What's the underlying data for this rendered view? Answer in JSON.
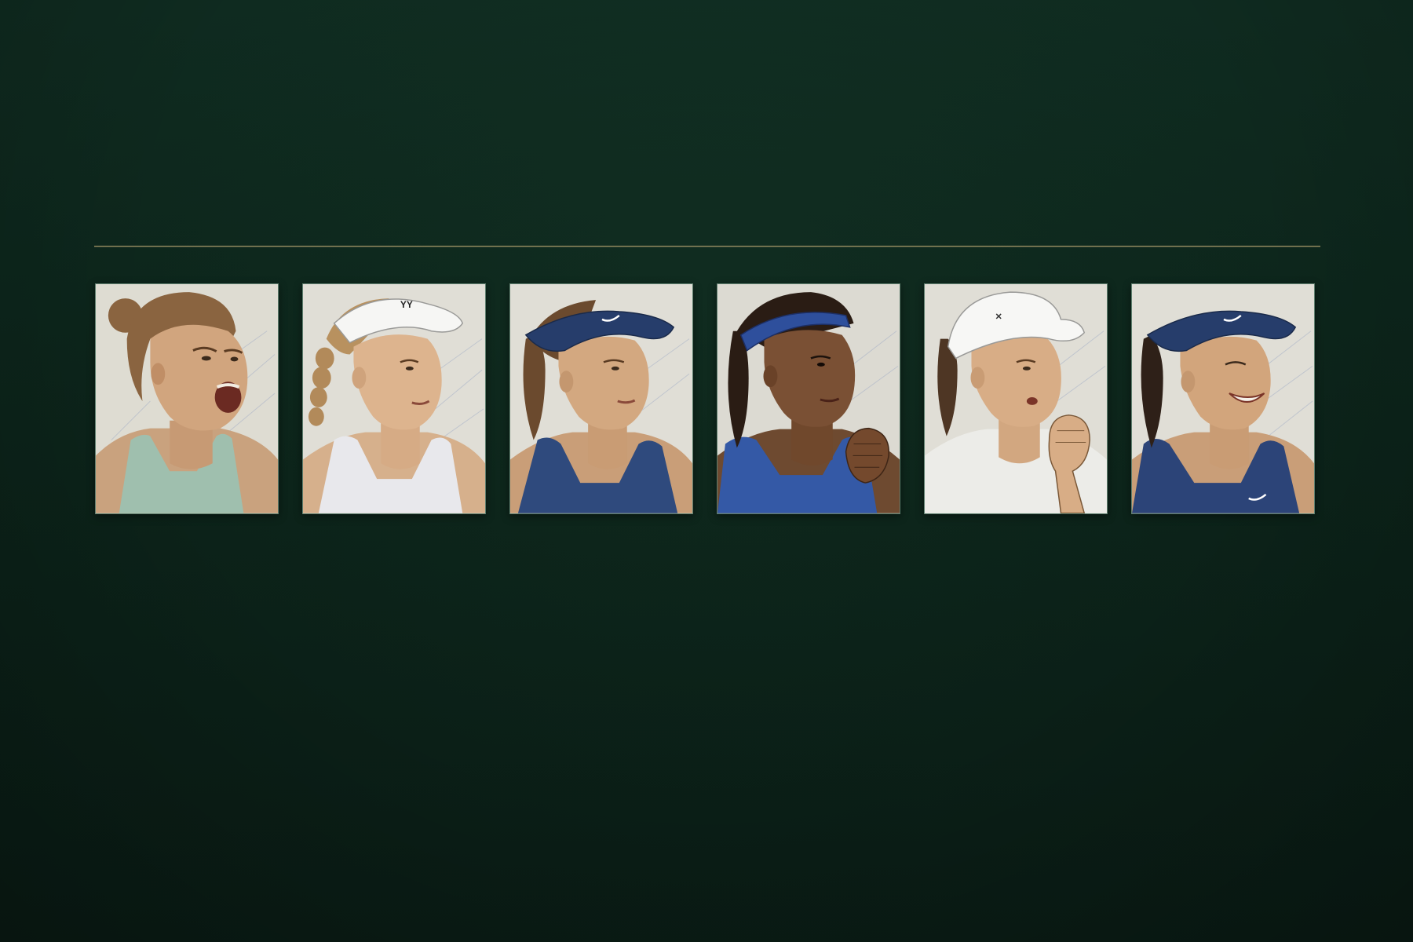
{
  "colors": {
    "background_top": "#0f2b20",
    "background_bottom": "#0a1c15",
    "divider": "#a89a6a",
    "card_border": "#5f7f6f",
    "paper": "#dcdcd4"
  },
  "portraits": [
    {
      "icon": "player-portrait-1",
      "expression": "shouting",
      "headwear": "none",
      "top": "sage-tank",
      "hair": "brown-bun"
    },
    {
      "icon": "player-portrait-2",
      "expression": "focused",
      "headwear": "white-visor",
      "top": "white-tank",
      "hair": "blonde-braid"
    },
    {
      "icon": "player-portrait-3",
      "expression": "focused",
      "headwear": "navy-visor",
      "top": "navy-tank",
      "hair": "brown-ponytail"
    },
    {
      "icon": "player-portrait-4",
      "expression": "determined",
      "headwear": "blue-headband",
      "top": "blue-tank",
      "hair": "dark-braids"
    },
    {
      "icon": "player-portrait-5",
      "expression": "fist-pump",
      "headwear": "white-cap",
      "top": "white-shirt",
      "hair": "dark-ponytail"
    },
    {
      "icon": "player-portrait-6",
      "expression": "smiling",
      "headwear": "navy-visor",
      "top": "navy-tank",
      "hair": "dark-ponytail"
    }
  ]
}
